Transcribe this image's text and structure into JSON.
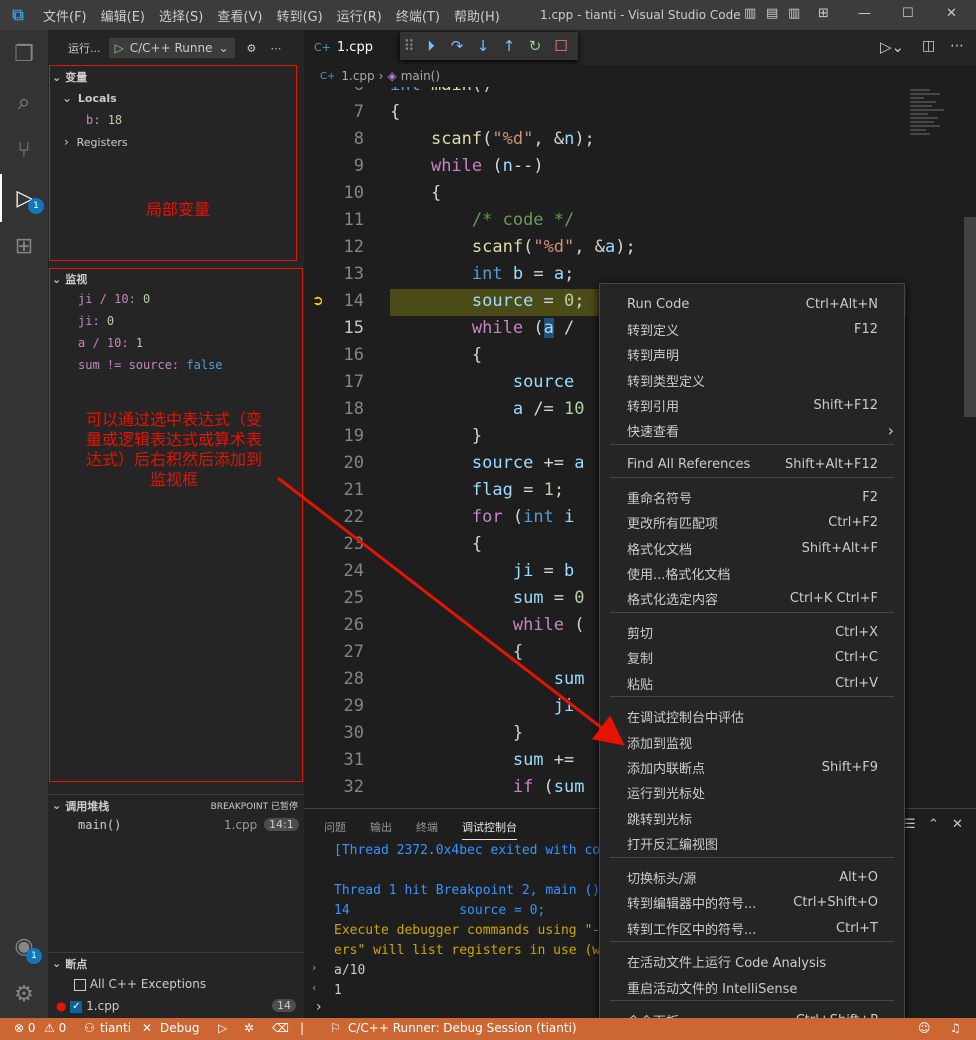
{
  "titlebar": {
    "logo": "⧉",
    "menus": [
      "文件(F)",
      "编辑(E)",
      "选择(S)",
      "查看(V)",
      "转到(G)",
      "运行(R)",
      "终端(T)",
      "帮助(H)"
    ],
    "title": "1.cpp - tianti - Visual Studio Code"
  },
  "activity": {
    "debug_badge": "1",
    "account_badge": "1"
  },
  "sidebar": {
    "run_label": "运行...",
    "config": "C/C++ Runne",
    "variables_title": "变量",
    "locals_label": "Locals",
    "local_var_name": "b:",
    "local_var_value": "18",
    "registers_label": "Registers",
    "variables_note": "局部变量",
    "watch_title": "监视",
    "watch": [
      {
        "expr": "ji / 10:",
        "value": "0"
      },
      {
        "expr": "ji:",
        "value": "0"
      },
      {
        "expr": "a / 10:",
        "value": "1"
      },
      {
        "expr": "sum != source:",
        "value": "false"
      }
    ],
    "watch_note": "可以通过选中表达式（变量或逻辑表达式或算术表达式）后右积然后添加到监视框",
    "callstack_title": "调用堆栈",
    "callstack_status": "BREAKPOINT 已暂停",
    "callstack_frame": "main()",
    "callstack_file": "1.cpp",
    "callstack_pos": "14:1",
    "breakpoints_title": "断点",
    "bp_exceptions": "All C++ Exceptions",
    "bp_file": "1.cpp",
    "bp_count": "14"
  },
  "editor": {
    "tab": "1.cpp",
    "breadcrumb_file": "1.cpp",
    "breadcrumb_symbol": "main()"
  },
  "panel": {
    "tabs": [
      "问题",
      "输出",
      "终端",
      "调试控制台"
    ],
    "lines": [
      "[Thread 2372.0x4bec exited with cod",
      "",
      "Thread 1 hit Breakpoint 2, main ()",
      "14              source = 0;",
      "Execute debugger commands using \"-e                              regist",
      "ers\" will list registers in use (wh",
      "a/10",
      "1"
    ]
  },
  "context_menu": {
    "items": [
      {
        "label": "Run Code",
        "key": "Ctrl+Alt+N"
      },
      {
        "label": "转到定义",
        "key": "F12"
      },
      {
        "label": "转到声明",
        "key": ""
      },
      {
        "label": "转到类型定义",
        "key": ""
      },
      {
        "label": "转到引用",
        "key": "Shift+F12"
      },
      {
        "label": "快速查看",
        "key": "›"
      },
      {
        "label": "Find All References",
        "key": "Shift+Alt+F12"
      },
      {
        "label": "重命名符号",
        "key": "F2"
      },
      {
        "label": "更改所有匹配项",
        "key": "Ctrl+F2"
      },
      {
        "label": "格式化文档",
        "key": "Shift+Alt+F"
      },
      {
        "label": "使用...格式化文档",
        "key": ""
      },
      {
        "label": "格式化选定内容",
        "key": "Ctrl+K Ctrl+F"
      },
      {
        "label": "剪切",
        "key": "Ctrl+X"
      },
      {
        "label": "复制",
        "key": "Ctrl+C"
      },
      {
        "label": "粘贴",
        "key": "Ctrl+V"
      },
      {
        "label": "在调试控制台中评估",
        "key": ""
      },
      {
        "label": "添加到监视",
        "key": ""
      },
      {
        "label": "添加内联断点",
        "key": "Shift+F9"
      },
      {
        "label": "运行到光标处",
        "key": ""
      },
      {
        "label": "跳转到光标",
        "key": ""
      },
      {
        "label": "打开反汇编视图",
        "key": ""
      },
      {
        "label": "切换标头/源",
        "key": "Alt+O"
      },
      {
        "label": "转到编辑器中的符号...",
        "key": "Ctrl+Shift+O"
      },
      {
        "label": "转到工作区中的符号...",
        "key": "Ctrl+T"
      },
      {
        "label": "在活动文件上运行 Code Analysis",
        "key": ""
      },
      {
        "label": "重启活动文件的 IntelliSense",
        "key": ""
      },
      {
        "label": "命令面板...",
        "key": "Ctrl+Shift+P"
      }
    ]
  },
  "statusbar": {
    "errors": "⊗ 0",
    "warnings": "⚠ 0",
    "folder": "tianti",
    "debug": "Debug",
    "session": "C/C++ Runner: Debug Session (tianti)"
  },
  "colors": {
    "accent": "#007acc",
    "statusbar": "#cc6633",
    "annotation": "#e51400"
  }
}
